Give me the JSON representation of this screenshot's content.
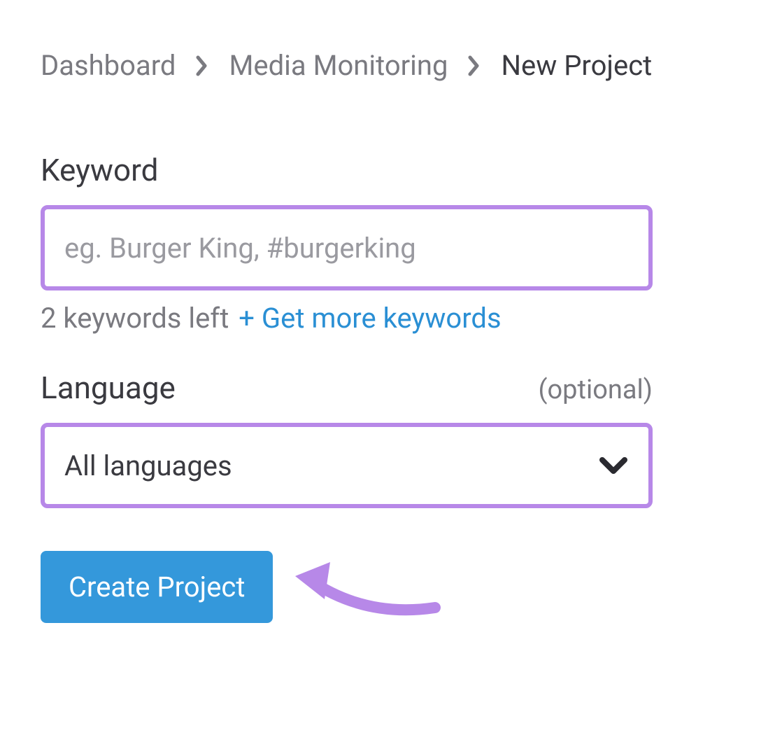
{
  "breadcrumb": {
    "items": [
      {
        "label": "Dashboard",
        "current": false
      },
      {
        "label": "Media Monitoring",
        "current": false
      },
      {
        "label": "New Project",
        "current": true
      }
    ]
  },
  "keyword_field": {
    "label": "Keyword",
    "placeholder": "eg. Burger King, #burgerking",
    "value": "",
    "helper_text": "2 keywords left",
    "helper_link": "+ Get more keywords"
  },
  "language_field": {
    "label": "Language",
    "optional_text": "(optional)",
    "selected": "All languages"
  },
  "actions": {
    "create_label": "Create Project"
  },
  "colors": {
    "highlight_border": "#b788e8",
    "primary_button": "#3498db",
    "link": "#2a8fd4",
    "text_primary": "#3a3a40",
    "text_secondary": "#7a7a80",
    "annotation_arrow": "#b788e8"
  }
}
